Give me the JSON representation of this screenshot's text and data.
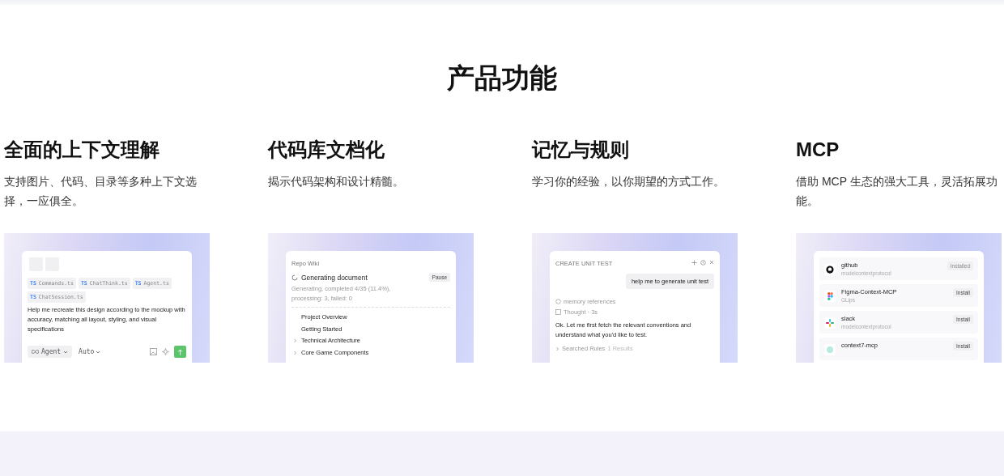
{
  "heading": "产品功能",
  "features": [
    {
      "title": "全面的上下文理解",
      "description": "支持图片、代码、目录等多种上下文选择，一应俱全。",
      "preview": {
        "kind": "chat",
        "files": [
          {
            "lang": "TS",
            "name": "Commands.ts"
          },
          {
            "lang": "TS",
            "name": "ChatThink.ts"
          },
          {
            "lang": "TS",
            "name": "Agent.ts"
          },
          {
            "lang": "TS",
            "name": "ChatSession.ts"
          }
        ],
        "prompt": "Help me recreate this design according to the mockup with accuracy, matching all layout, styling, and visual specifications",
        "mode": "Agent",
        "model": "Auto"
      }
    },
    {
      "title": "代码库文档化",
      "description": "揭示代码架构和设计精髓。",
      "preview": {
        "kind": "wiki",
        "title": "Repo Wiki",
        "status": "Generating document",
        "button": "Pause",
        "progress": "Generating, completed 4/35 (11.4%), processing: 3, failed: 0",
        "items": [
          {
            "label": "Project Overview",
            "expandable": false
          },
          {
            "label": "Getting Started",
            "expandable": false
          },
          {
            "label": "Technical Architecture",
            "expandable": true
          },
          {
            "label": "Core Game Components",
            "expandable": true
          }
        ]
      }
    },
    {
      "title": "记忆与规则",
      "description": "学习你的经验，以你期望的方式工作。",
      "preview": {
        "kind": "memory",
        "title": "CREATE UNIT TEST",
        "message": "help me to generate unit test",
        "memory": "memory references",
        "thought": "Thought · 3s",
        "reply": "Ok. Let me first fetch the relevant conventions and understand what you'd like to test.",
        "search": "Searched Rules",
        "results": "1 Results"
      }
    },
    {
      "title": "MCP",
      "description": "借助 MCP 生态的强大工具，灵活拓展功能。",
      "preview": {
        "kind": "mcp",
        "servers": [
          {
            "kind": "github",
            "name": "github",
            "author": "modelcontextprotocol",
            "action": "Installed",
            "installed": true
          },
          {
            "kind": "figma",
            "name": "Figma-Context-MCP",
            "author": "GLips",
            "action": "Install",
            "installed": false
          },
          {
            "kind": "slack",
            "name": "slack",
            "author": "modelcontextprotocol",
            "action": "Install",
            "installed": false
          },
          {
            "kind": "context7",
            "name": "context7-mcp",
            "action": "Install",
            "installed": false
          }
        ]
      }
    }
  ]
}
